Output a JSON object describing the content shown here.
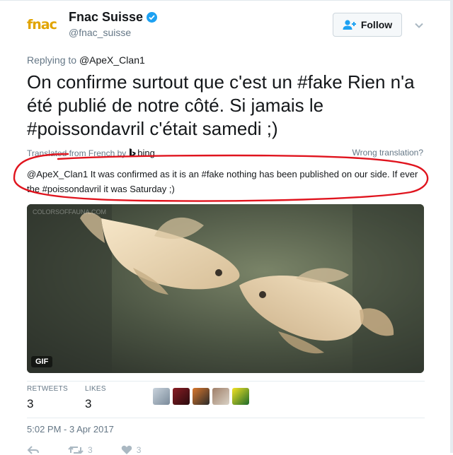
{
  "header": {
    "logo_text": "fnac",
    "display_name": "Fnac Suisse",
    "handle": "@fnac_suisse",
    "follow_label": "Follow"
  },
  "reply": {
    "prefix": "Replying to ",
    "mention": "@ApeX_Clan1"
  },
  "tweet": {
    "text": "On confirme surtout que c'est un #fake Rien n'a été publié de notre côté. Si jamais le #poissondavril c'était samedi ;)"
  },
  "translation": {
    "label": "Translated from French by",
    "provider": "bing",
    "wrong_label": "Wrong translation?",
    "text": "@ApeX_Clan1 It was confirmed as it is an #fake nothing has been published on our side. If ever the #poissondavril it was Saturday ;)"
  },
  "media": {
    "badge": "GIF",
    "watermark": "COLORSOFFAUNA.COM"
  },
  "stats": {
    "retweets_label": "RETWEETS",
    "retweets_count": "3",
    "likes_label": "LIKES",
    "likes_count": "3"
  },
  "timestamp": "5:02 PM - 3 Apr 2017",
  "actions": {
    "retweet_count": "3",
    "like_count": "3"
  },
  "colors": {
    "accent": "#1da1f2",
    "annotation": "#e0141e",
    "logo": "#e1a400"
  }
}
